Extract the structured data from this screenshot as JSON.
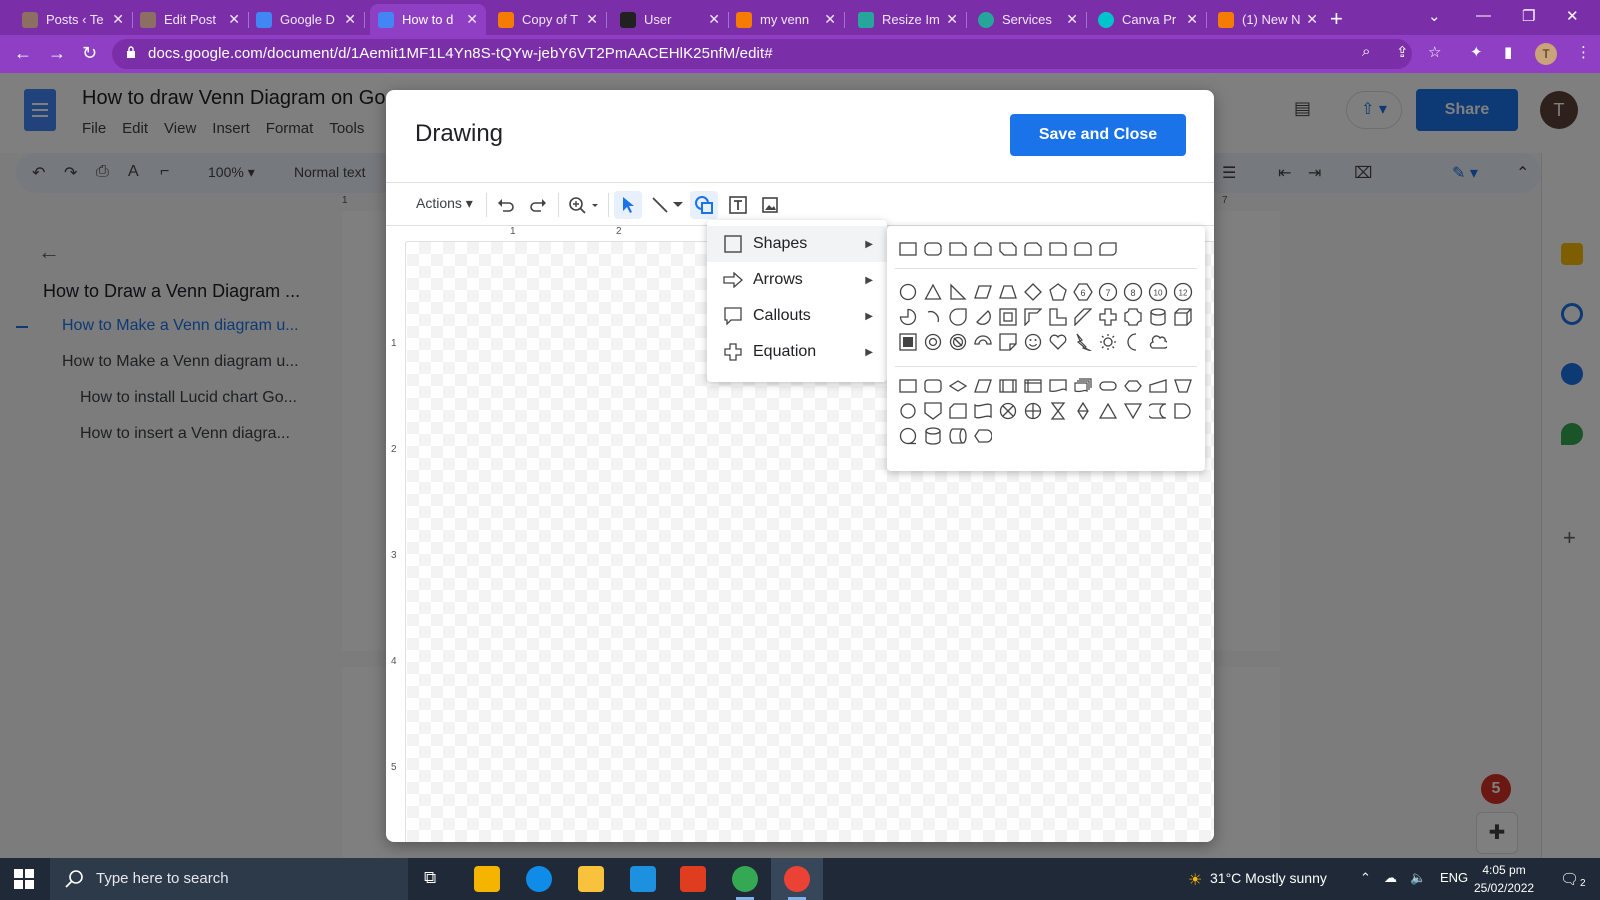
{
  "browser": {
    "tabs": [
      {
        "label": "Posts ‹ Te",
        "fav_color": "#8d6e63"
      },
      {
        "label": "Edit Post",
        "fav_color": "#8d6e63"
      },
      {
        "label": "Google D",
        "fav_color": "#4285f4"
      },
      {
        "label": "How to d",
        "fav_color": "#4285f4"
      },
      {
        "label": "Copy of T",
        "fav_color": "#f57c00"
      },
      {
        "label": "User",
        "fav_color": "#212121"
      },
      {
        "label": "my venn",
        "fav_color": "#f57c00"
      },
      {
        "label": "Resize Im",
        "fav_color": "#26a69a"
      },
      {
        "label": "Services",
        "fav_color": "#26a69a"
      },
      {
        "label": "Canva Pr",
        "fav_color": "#00c4cc"
      },
      {
        "label": "(1) New N",
        "fav_color": "#f57c00"
      }
    ],
    "active_tab_index": 3,
    "new_tab": "+",
    "url": "docs.google.com/document/d/1Aemit1MF1L4Yn8S-tQYw-jebY6VT2PmAACEHlK25nfM/edit#",
    "profile_initial": "T"
  },
  "docs": {
    "title": "How to draw Venn Diagram on Go",
    "menu": [
      "File",
      "Edit",
      "View",
      "Insert",
      "Format",
      "Tools"
    ],
    "zoom": "100%",
    "style": "Normal text",
    "share_label": "Share",
    "user_initial": "T",
    "outline": [
      {
        "text": "How to Draw a Venn Diagram ...",
        "level": "h1"
      },
      {
        "text": "How to Make a Venn diagram u...",
        "level": "current"
      },
      {
        "text": "How to Make a Venn diagram u...",
        "level": "h2"
      },
      {
        "text": "How to install Lucid chart Go...",
        "level": "h3"
      },
      {
        "text": "How to insert a Venn diagra...",
        "level": "h3"
      }
    ],
    "ruler_top": [
      "1",
      "7"
    ],
    "notification_count": "5"
  },
  "dialog": {
    "title": "Drawing",
    "save_close": "Save and Close",
    "actions_label": "Actions",
    "ruler_top": [
      "1",
      "2"
    ],
    "ruler_left": [
      "1",
      "2",
      "3",
      "4",
      "5"
    ],
    "insert_menu": [
      {
        "label": "Shapes",
        "icon": "square-icon"
      },
      {
        "label": "Arrows",
        "icon": "arrow-icon"
      },
      {
        "label": "Callouts",
        "icon": "callout-icon"
      },
      {
        "label": "Equation",
        "icon": "plus-icon"
      }
    ],
    "shape_badges": [
      "6",
      "7",
      "8",
      "10",
      "12"
    ]
  },
  "taskbar": {
    "search_placeholder": "Type here to search",
    "weather": "31°C  Mostly sunny",
    "language": "ENG",
    "time": "4:05 pm",
    "date": "25/02/2022",
    "notifications": "2"
  }
}
